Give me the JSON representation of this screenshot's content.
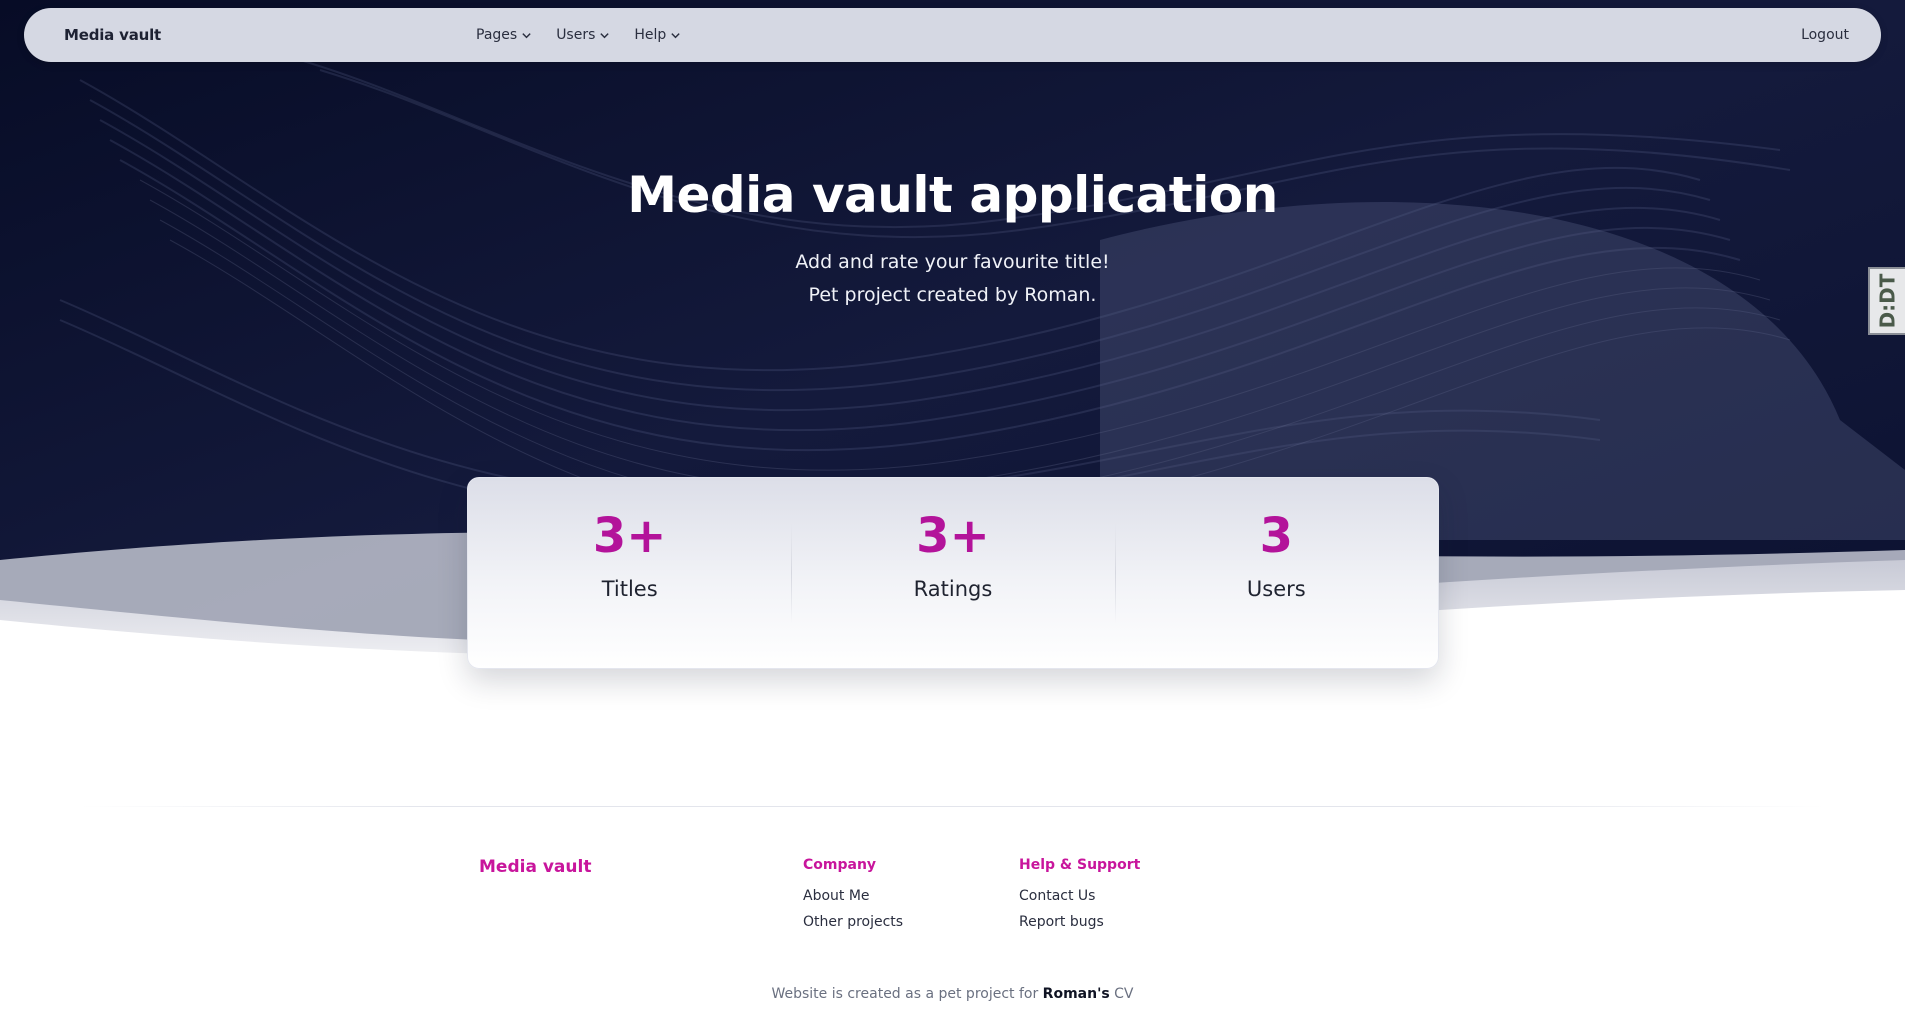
{
  "navbar": {
    "brand": "Media vault",
    "links": [
      {
        "label": "Pages"
      },
      {
        "label": "Users"
      },
      {
        "label": "Help"
      }
    ],
    "logout": "Logout"
  },
  "hero": {
    "title": "Media vault application",
    "subtitle_line1": "Add and rate your favourite title!",
    "subtitle_line2": "Pet project created by Roman."
  },
  "side_tab": {
    "label": "D:DT"
  },
  "stats": [
    {
      "value": "3+",
      "label": "Titles"
    },
    {
      "value": "3+",
      "label": "Ratings"
    },
    {
      "value": "3",
      "label": "Users"
    }
  ],
  "footer": {
    "brand": "Media vault",
    "company": {
      "title": "Company",
      "links": [
        "About Me",
        "Other projects"
      ]
    },
    "help": {
      "title": "Help & Support",
      "links": [
        "Contact Us",
        "Report bugs"
      ]
    },
    "credit": {
      "prefix": "Website is created as a pet project for ",
      "name": "Roman's",
      "suffix": " CV"
    }
  },
  "colors": {
    "accent": "#c8159c",
    "stat_value": "#b3139a",
    "hero_bg": "#0a1030",
    "navbar_bg": "#d5d8e3"
  },
  "icons": {
    "nav_dropdown": "chevron-down-icon"
  }
}
